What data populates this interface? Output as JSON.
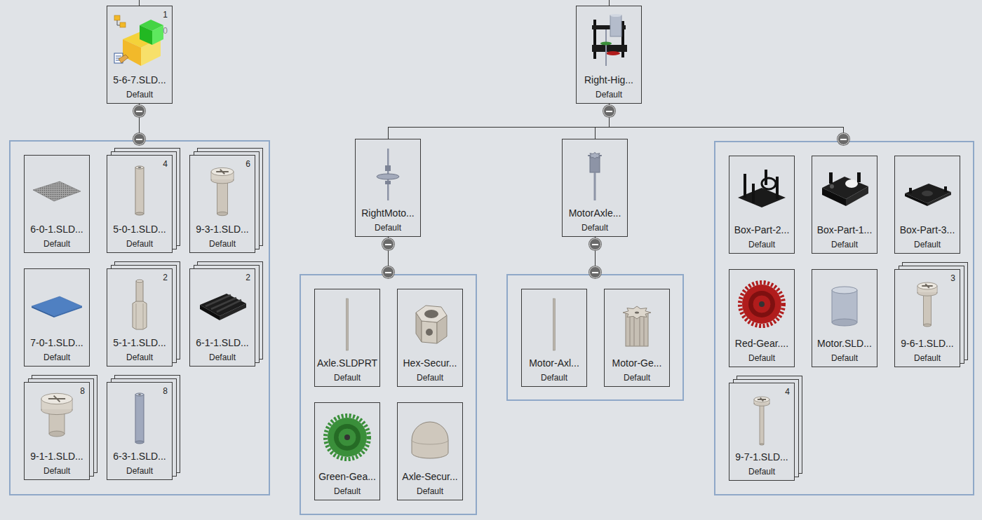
{
  "trees": [
    {
      "name": "5-6-7.SLD...",
      "config": "Default",
      "count": "1",
      "sub_count": "0",
      "expanded": true,
      "parts": {
        "expanded": true,
        "items": [
          {
            "name": "6-0-1.SLD...",
            "config": "Default",
            "count": null
          },
          {
            "name": "5-0-1.SLD...",
            "config": "Default",
            "count": "4"
          },
          {
            "name": "9-3-1.SLD...",
            "config": "Default",
            "count": "6"
          },
          {
            "name": "7-0-1.SLD...",
            "config": "Default",
            "count": null
          },
          {
            "name": "5-1-1.SLD...",
            "config": "Default",
            "count": "2"
          },
          {
            "name": "6-1-1.SLD...",
            "config": "Default",
            "count": "2"
          },
          {
            "name": "9-1-1.SLD...",
            "config": "Default",
            "count": "8"
          },
          {
            "name": "6-3-1.SLD...",
            "config": "Default",
            "count": "8"
          }
        ]
      }
    },
    {
      "name": "Right-Hig...",
      "config": "Default",
      "expanded": true,
      "subassemblies": [
        {
          "name": "RightMoto...",
          "config": "Default",
          "expanded": true,
          "parts": {
            "expanded": true,
            "items": [
              {
                "name": "Axle.SLDPRT",
                "config": "Default",
                "count": null
              },
              {
                "name": "Hex-Secur...",
                "config": "Default",
                "count": null
              },
              {
                "name": "Green-Gea...",
                "config": "Default",
                "count": null
              },
              {
                "name": "Axle-Secur...",
                "config": "Default",
                "count": null
              }
            ]
          }
        },
        {
          "name": "MotorAxle...",
          "config": "Default",
          "expanded": true,
          "parts": {
            "expanded": true,
            "items": [
              {
                "name": "Motor-Axl...",
                "config": "Default",
                "count": null
              },
              {
                "name": "Motor-Ge...",
                "config": "Default",
                "count": null
              }
            ]
          }
        }
      ],
      "parts": {
        "expanded": true,
        "items": [
          {
            "name": "Box-Part-2...",
            "config": "Default",
            "count": null
          },
          {
            "name": "Box-Part-1...",
            "config": "Default",
            "count": null
          },
          {
            "name": "Box-Part-3...",
            "config": "Default",
            "count": null
          },
          {
            "name": "Red-Gear....",
            "config": "Default",
            "count": null
          },
          {
            "name": "Motor.SLD...",
            "config": "Default",
            "count": null
          },
          {
            "name": "9-6-1.SLD...",
            "config": "Default",
            "count": "3"
          },
          {
            "name": "9-7-1.SLD...",
            "config": "Default",
            "count": "4"
          }
        ]
      }
    }
  ]
}
